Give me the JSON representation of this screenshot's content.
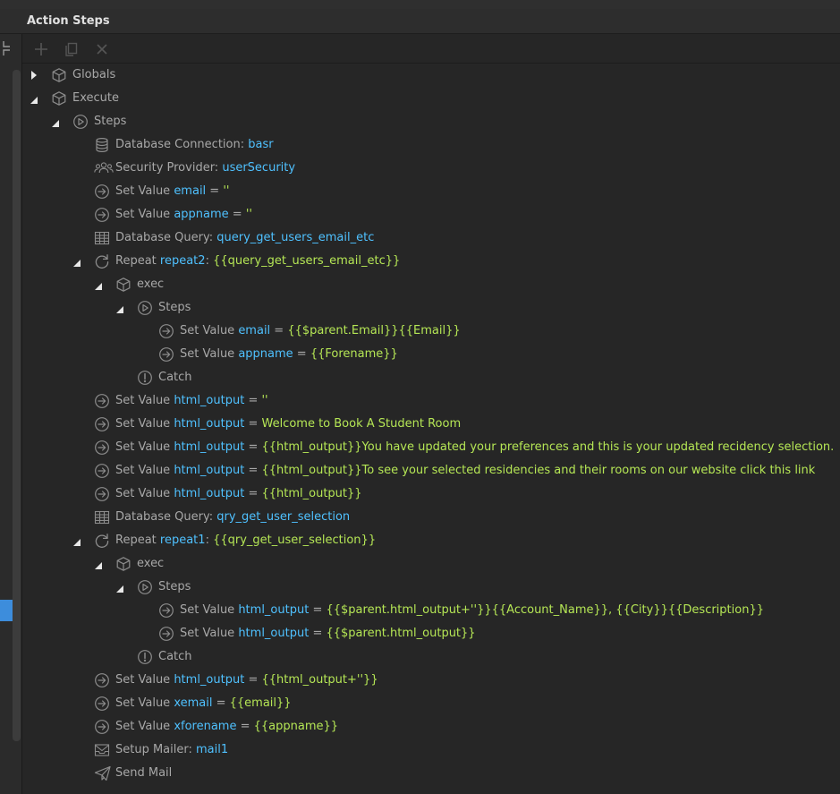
{
  "window": {
    "title": "Action Steps"
  },
  "tree": [
    {
      "depth": 0,
      "expand": "collapsed",
      "icon": "cube",
      "parts": [
        [
          "g",
          "Globals"
        ]
      ]
    },
    {
      "depth": 0,
      "expand": "expanded",
      "icon": "cube",
      "parts": [
        [
          "g",
          "Execute"
        ]
      ]
    },
    {
      "depth": 1,
      "expand": "expanded",
      "icon": "play",
      "parts": [
        [
          "g",
          "Steps"
        ]
      ]
    },
    {
      "depth": 2,
      "expand": "none",
      "icon": "database",
      "parts": [
        [
          "g",
          "Database Connection: "
        ],
        [
          "b",
          "basr"
        ]
      ]
    },
    {
      "depth": 2,
      "expand": "none",
      "icon": "users",
      "parts": [
        [
          "g",
          "Security Provider: "
        ],
        [
          "b",
          "userSecurity"
        ]
      ]
    },
    {
      "depth": 2,
      "expand": "none",
      "icon": "arrow",
      "parts": [
        [
          "g",
          "Set Value "
        ],
        [
          "b",
          "email"
        ],
        [
          "g",
          " = "
        ],
        [
          "y",
          "''"
        ]
      ]
    },
    {
      "depth": 2,
      "expand": "none",
      "icon": "arrow",
      "parts": [
        [
          "g",
          "Set Value "
        ],
        [
          "b",
          "appname"
        ],
        [
          "g",
          " = "
        ],
        [
          "y",
          "''"
        ]
      ]
    },
    {
      "depth": 2,
      "expand": "none",
      "icon": "table",
      "parts": [
        [
          "g",
          "Database Query: "
        ],
        [
          "b",
          "query_get_users_email_etc"
        ]
      ]
    },
    {
      "depth": 2,
      "expand": "expanded",
      "icon": "repeat",
      "parts": [
        [
          "g",
          "Repeat "
        ],
        [
          "b",
          "repeat2"
        ],
        [
          "g",
          ": "
        ],
        [
          "y",
          "{{query_get_users_email_etc}}"
        ]
      ]
    },
    {
      "depth": 3,
      "expand": "expanded",
      "icon": "cube",
      "parts": [
        [
          "g",
          "exec"
        ]
      ]
    },
    {
      "depth": 4,
      "expand": "expanded",
      "icon": "play",
      "parts": [
        [
          "g",
          "Steps"
        ]
      ]
    },
    {
      "depth": 5,
      "expand": "none",
      "icon": "arrow",
      "parts": [
        [
          "g",
          "Set Value "
        ],
        [
          "b",
          "email"
        ],
        [
          "g",
          " = "
        ],
        [
          "y",
          "{{$parent.Email}}{{Email}}"
        ]
      ]
    },
    {
      "depth": 5,
      "expand": "none",
      "icon": "arrow",
      "parts": [
        [
          "g",
          "Set Value "
        ],
        [
          "b",
          "appname"
        ],
        [
          "g",
          " = "
        ],
        [
          "y",
          "{{Forename}}"
        ]
      ]
    },
    {
      "depth": 4,
      "expand": "none",
      "icon": "alert",
      "parts": [
        [
          "g",
          "Catch"
        ]
      ]
    },
    {
      "depth": 2,
      "expand": "none",
      "icon": "arrow",
      "parts": [
        [
          "g",
          "Set Value "
        ],
        [
          "b",
          "html_output"
        ],
        [
          "g",
          " = "
        ],
        [
          "y",
          "''"
        ]
      ]
    },
    {
      "depth": 2,
      "expand": "none",
      "icon": "arrow",
      "parts": [
        [
          "g",
          "Set Value "
        ],
        [
          "b",
          "html_output"
        ],
        [
          "g",
          " = "
        ],
        [
          "y",
          "Welcome to Book A Student Room"
        ]
      ]
    },
    {
      "depth": 2,
      "expand": "none",
      "icon": "arrow",
      "parts": [
        [
          "g",
          "Set Value "
        ],
        [
          "b",
          "html_output"
        ],
        [
          "g",
          " = "
        ],
        [
          "y",
          "{{html_output}}You have updated your preferences and this is your updated recidency selection."
        ]
      ]
    },
    {
      "depth": 2,
      "expand": "none",
      "icon": "arrow",
      "parts": [
        [
          "g",
          "Set Value "
        ],
        [
          "b",
          "html_output"
        ],
        [
          "g",
          " = "
        ],
        [
          "y",
          "{{html_output}}To see your selected residencies and their rooms on our website click this link"
        ]
      ]
    },
    {
      "depth": 2,
      "expand": "none",
      "icon": "arrow",
      "parts": [
        [
          "g",
          "Set Value "
        ],
        [
          "b",
          "html_output"
        ],
        [
          "g",
          " = "
        ],
        [
          "y",
          "{{html_output}}"
        ]
      ]
    },
    {
      "depth": 2,
      "expand": "none",
      "icon": "table",
      "parts": [
        [
          "g",
          "Database Query: "
        ],
        [
          "b",
          "qry_get_user_selection"
        ]
      ]
    },
    {
      "depth": 2,
      "expand": "expanded",
      "icon": "repeat",
      "parts": [
        [
          "g",
          "Repeat "
        ],
        [
          "b",
          "repeat1"
        ],
        [
          "g",
          ": "
        ],
        [
          "y",
          "{{qry_get_user_selection}}"
        ]
      ]
    },
    {
      "depth": 3,
      "expand": "expanded",
      "icon": "cube",
      "parts": [
        [
          "g",
          "exec"
        ]
      ]
    },
    {
      "depth": 4,
      "expand": "expanded",
      "icon": "play",
      "parts": [
        [
          "g",
          "Steps"
        ]
      ]
    },
    {
      "depth": 5,
      "expand": "none",
      "icon": "arrow",
      "parts": [
        [
          "g",
          "Set Value "
        ],
        [
          "b",
          "html_output"
        ],
        [
          "g",
          " = "
        ],
        [
          "y",
          "{{$parent.html_output+''}}{{Account_Name}}, {{City}}{{Description}}"
        ]
      ]
    },
    {
      "depth": 5,
      "expand": "none",
      "icon": "arrow",
      "parts": [
        [
          "g",
          "Set Value "
        ],
        [
          "b",
          "html_output"
        ],
        [
          "g",
          " = "
        ],
        [
          "y",
          "{{$parent.html_output}}"
        ]
      ]
    },
    {
      "depth": 4,
      "expand": "none",
      "icon": "alert",
      "parts": [
        [
          "g",
          "Catch"
        ]
      ]
    },
    {
      "depth": 2,
      "expand": "none",
      "icon": "arrow",
      "parts": [
        [
          "g",
          "Set Value "
        ],
        [
          "b",
          "html_output"
        ],
        [
          "g",
          " = "
        ],
        [
          "y",
          "{{html_output+''}}"
        ]
      ]
    },
    {
      "depth": 2,
      "expand": "none",
      "icon": "arrow",
      "parts": [
        [
          "g",
          "Set Value "
        ],
        [
          "b",
          "xemail"
        ],
        [
          "g",
          " = "
        ],
        [
          "y",
          "{{email}}"
        ]
      ]
    },
    {
      "depth": 2,
      "expand": "none",
      "icon": "arrow",
      "parts": [
        [
          "g",
          "Set Value "
        ],
        [
          "b",
          "xforename"
        ],
        [
          "g",
          " = "
        ],
        [
          "y",
          "{{appname}}"
        ]
      ]
    },
    {
      "depth": 2,
      "expand": "none",
      "icon": "mail",
      "parts": [
        [
          "g",
          "Setup Mailer: "
        ],
        [
          "b",
          "mail1"
        ]
      ]
    },
    {
      "depth": 2,
      "expand": "none",
      "icon": "send",
      "parts": [
        [
          "g",
          "Send Mail"
        ]
      ]
    }
  ],
  "colors": {
    "label": "#a8a8a8",
    "identifier": "#4fc1ff",
    "value": "#b5e655",
    "background": "#262626",
    "accent": "#3d8ddc"
  }
}
